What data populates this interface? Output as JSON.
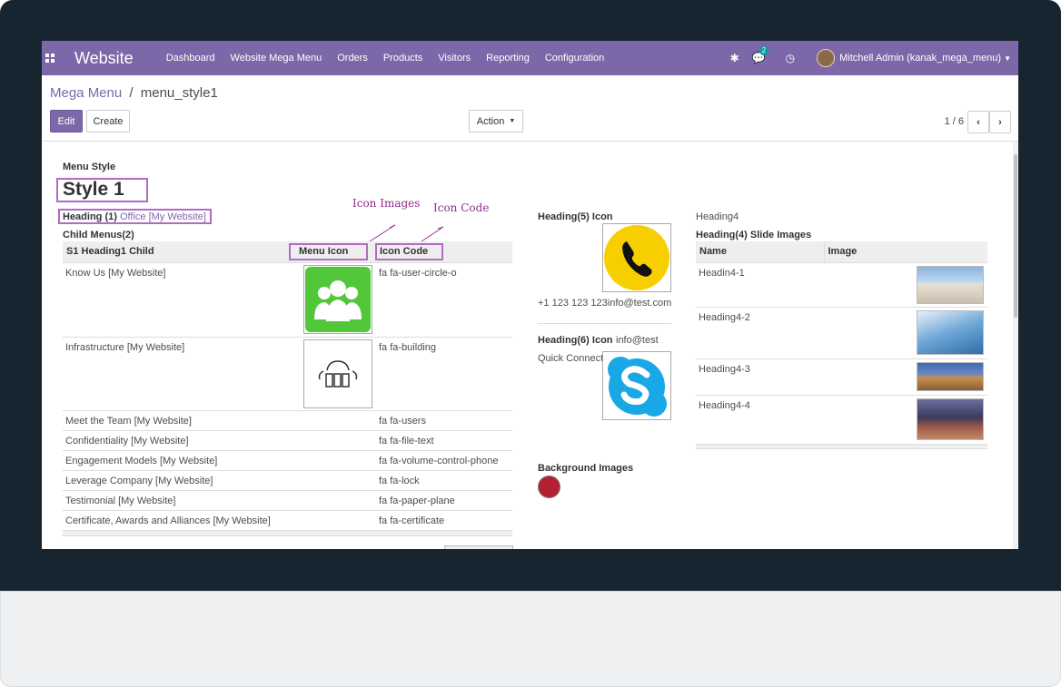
{
  "navbar": {
    "brand": "Website",
    "menu": [
      "Dashboard",
      "Website Mega Menu",
      "Orders",
      "Products",
      "Visitors",
      "Reporting",
      "Configuration"
    ],
    "messages_count": "2",
    "user": "Mitchell Admin (kanak_mega_menu)"
  },
  "breadcrumb": {
    "parent": "Mega Menu",
    "separator": "/",
    "current": "menu_style1"
  },
  "buttons": {
    "edit": "Edit",
    "create": "Create",
    "action": "Action"
  },
  "pager": {
    "text": "1 / 6"
  },
  "form": {
    "menu_style_label": "Menu Style",
    "menu_style_value": "Style 1",
    "heading1_label": "Heading (1)",
    "heading1_value": "Office [My Website]",
    "child_menus_label": "Child Menus(2)",
    "annotations": {
      "icon_images": "Icon  Images",
      "icon_code": "Icon  Code"
    },
    "child_table": {
      "headers": [
        "S1 Heading1 Child",
        "Menu Icon",
        "Icon Code"
      ],
      "rows": [
        {
          "name": "Know Us [My Website]",
          "code": "fa fa-user-circle-o"
        },
        {
          "name": "Infrastructure [My Website]",
          "code": "fa fa-building"
        },
        {
          "name": "Meet the Team [My Website]",
          "code": "fa fa-users"
        },
        {
          "name": "Confidentiality [My Website]",
          "code": "fa fa-file-text"
        },
        {
          "name": "Engagement Models [My Website]",
          "code": "fa fa-volume-control-phone"
        },
        {
          "name": "Leverage Company [My Website]",
          "code": "fa fa-lock"
        },
        {
          "name": "Testimonial [My Website]",
          "code": "fa fa-paper-plane"
        },
        {
          "name": "Certificate, Awards and Alliances [My Website]",
          "code": "fa fa-certificate"
        }
      ]
    },
    "heading5_label": "Heading(5) Icon",
    "heading5_text": "+1 123 123 123info@test.com",
    "heading6_label": "Heading(6) Icon",
    "heading6_value": "info@test",
    "quick_connect": "Quick Connect",
    "background_images_label": "Background Images",
    "background_color": "#b32034",
    "heading4_value": "Heading4",
    "heading4_slide_label": "Heading(4) Slide Images",
    "slide_table": {
      "headers": [
        "Name",
        "Image"
      ],
      "rows": [
        "Headin4-1",
        "Heading4-2",
        "Heading4-3",
        "Heading4-4"
      ]
    }
  }
}
